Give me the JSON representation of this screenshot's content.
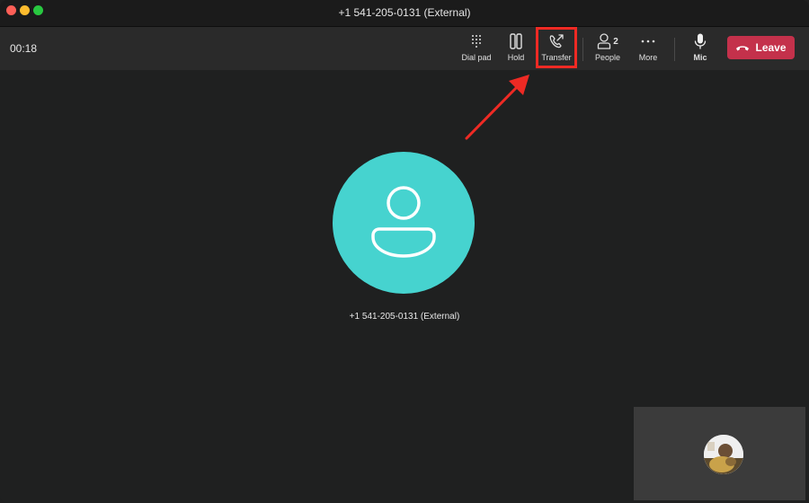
{
  "window": {
    "title": "+1 541-205-0131 (External)"
  },
  "toolbar": {
    "timer": "00:18",
    "dial_pad_label": "Dial pad",
    "hold_label": "Hold",
    "transfer_label": "Transfer",
    "people_label": "People",
    "people_count": "2",
    "more_label": "More",
    "mic_label": "Mic",
    "leave_label": "Leave"
  },
  "call": {
    "caller_name": "+1 541-205-0131 (External)"
  },
  "icons": {
    "dial_pad": "dialpad-icon",
    "hold": "pause-icon",
    "transfer": "phone-forward-icon",
    "people": "person-icon",
    "more": "more-dots-icon",
    "mic": "microphone-icon",
    "leave": "phone-hangup-icon"
  },
  "colors": {
    "leave_button": "#c4314b",
    "avatar": "#46d3cf",
    "highlight": "#ee2a24"
  }
}
